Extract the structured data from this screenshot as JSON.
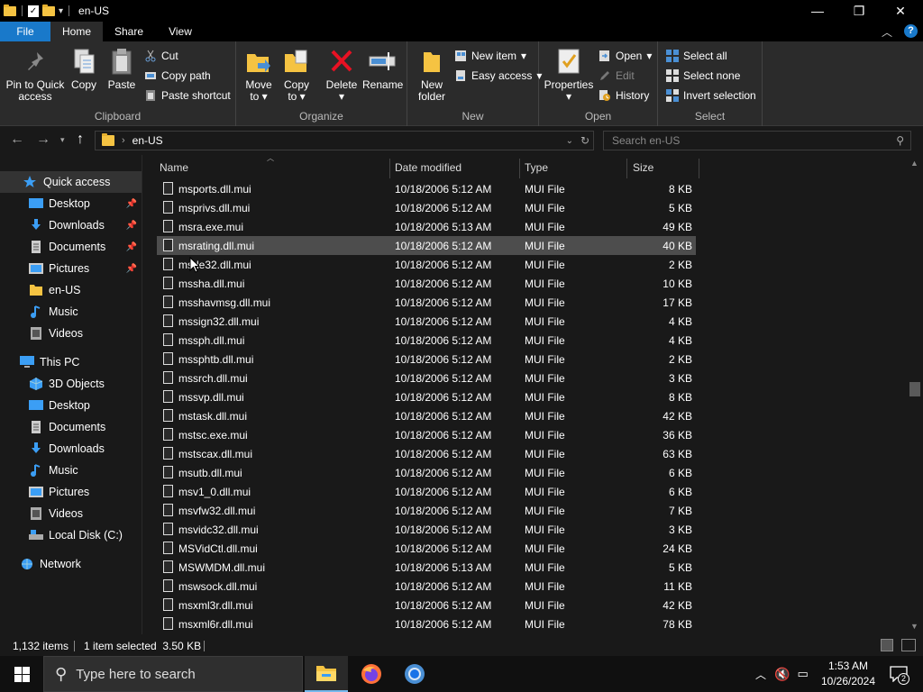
{
  "window": {
    "title": "en-US",
    "controls": {
      "minimize": "—",
      "maximize": "❐",
      "close": "✕"
    }
  },
  "ribbon_tabs": [
    {
      "label": "File"
    },
    {
      "label": "Home"
    },
    {
      "label": "Share"
    },
    {
      "label": "View"
    }
  ],
  "ribbon": {
    "clipboard": {
      "label": "Clipboard",
      "pin": "Pin to Quick\naccess",
      "pin_l1": "Pin to Quick",
      "pin_l2": "access",
      "copy": "Copy",
      "paste": "Paste",
      "cut": "Cut",
      "copy_path": "Copy path",
      "paste_shortcut": "Paste shortcut"
    },
    "organize": {
      "label": "Organize",
      "move_l1": "Move",
      "move_l2": "to",
      "copy_l1": "Copy",
      "copy_l2": "to",
      "delete": "Delete",
      "rename": "Rename"
    },
    "new": {
      "label": "New",
      "folder_l1": "New",
      "folder_l2": "folder",
      "new_item": "New item",
      "easy_access": "Easy access"
    },
    "open": {
      "label": "Open",
      "properties": "Properties",
      "open": "Open",
      "edit": "Edit",
      "history": "History"
    },
    "select": {
      "label": "Select",
      "select_all": "Select all",
      "select_none": "Select none",
      "invert": "Invert selection"
    }
  },
  "address": {
    "path": "en-US",
    "search_placeholder": "Search en-US"
  },
  "nav": {
    "quick_access": "Quick access",
    "items": [
      {
        "label": "Desktop",
        "icon": "desktop-icon",
        "pinned": true
      },
      {
        "label": "Downloads",
        "icon": "downloads-icon",
        "pinned": true
      },
      {
        "label": "Documents",
        "icon": "documents-icon",
        "pinned": true
      },
      {
        "label": "Pictures",
        "icon": "pictures-icon",
        "pinned": true
      },
      {
        "label": "en-US",
        "icon": "folder-icon",
        "pinned": false
      },
      {
        "label": "Music",
        "icon": "music-icon",
        "pinned": false
      },
      {
        "label": "Videos",
        "icon": "videos-icon",
        "pinned": false
      }
    ],
    "this_pc": "This PC",
    "pc_items": [
      {
        "label": "3D Objects",
        "icon": "3d-objects-icon"
      },
      {
        "label": "Desktop",
        "icon": "desktop-icon"
      },
      {
        "label": "Documents",
        "icon": "documents-icon"
      },
      {
        "label": "Downloads",
        "icon": "downloads-icon"
      },
      {
        "label": "Music",
        "icon": "music-icon"
      },
      {
        "label": "Pictures",
        "icon": "pictures-icon"
      },
      {
        "label": "Videos",
        "icon": "videos-icon"
      },
      {
        "label": "Local Disk (C:)",
        "icon": "local-disk-icon"
      }
    ],
    "network": "Network"
  },
  "columns": {
    "name": "Name",
    "date": "Date modified",
    "type": "Type",
    "size": "Size"
  },
  "files": [
    {
      "name": "msports.dll.mui",
      "date": "10/18/2006 5:12 AM",
      "type": "MUI File",
      "size": "8 KB"
    },
    {
      "name": "msprivs.dll.mui",
      "date": "10/18/2006 5:12 AM",
      "type": "MUI File",
      "size": "5 KB"
    },
    {
      "name": "msra.exe.mui",
      "date": "10/18/2006 5:13 AM",
      "type": "MUI File",
      "size": "49 KB"
    },
    {
      "name": "msrating.dll.mui",
      "date": "10/18/2006 5:12 AM",
      "type": "MUI File",
      "size": "40 KB",
      "selected": true
    },
    {
      "name": "msrle32.dll.mui",
      "date": "10/18/2006 5:12 AM",
      "type": "MUI File",
      "size": "2 KB"
    },
    {
      "name": "mssha.dll.mui",
      "date": "10/18/2006 5:12 AM",
      "type": "MUI File",
      "size": "10 KB"
    },
    {
      "name": "msshavmsg.dll.mui",
      "date": "10/18/2006 5:12 AM",
      "type": "MUI File",
      "size": "17 KB"
    },
    {
      "name": "mssign32.dll.mui",
      "date": "10/18/2006 5:12 AM",
      "type": "MUI File",
      "size": "4 KB"
    },
    {
      "name": "mssph.dll.mui",
      "date": "10/18/2006 5:12 AM",
      "type": "MUI File",
      "size": "4 KB"
    },
    {
      "name": "mssphtb.dll.mui",
      "date": "10/18/2006 5:12 AM",
      "type": "MUI File",
      "size": "2 KB"
    },
    {
      "name": "mssrch.dll.mui",
      "date": "10/18/2006 5:12 AM",
      "type": "MUI File",
      "size": "3 KB"
    },
    {
      "name": "mssvp.dll.mui",
      "date": "10/18/2006 5:12 AM",
      "type": "MUI File",
      "size": "8 KB"
    },
    {
      "name": "mstask.dll.mui",
      "date": "10/18/2006 5:12 AM",
      "type": "MUI File",
      "size": "42 KB"
    },
    {
      "name": "mstsc.exe.mui",
      "date": "10/18/2006 5:12 AM",
      "type": "MUI File",
      "size": "36 KB"
    },
    {
      "name": "mstscax.dll.mui",
      "date": "10/18/2006 5:12 AM",
      "type": "MUI File",
      "size": "63 KB"
    },
    {
      "name": "msutb.dll.mui",
      "date": "10/18/2006 5:12 AM",
      "type": "MUI File",
      "size": "6 KB"
    },
    {
      "name": "msv1_0.dll.mui",
      "date": "10/18/2006 5:12 AM",
      "type": "MUI File",
      "size": "6 KB"
    },
    {
      "name": "msvfw32.dll.mui",
      "date": "10/18/2006 5:12 AM",
      "type": "MUI File",
      "size": "7 KB"
    },
    {
      "name": "msvidc32.dll.mui",
      "date": "10/18/2006 5:12 AM",
      "type": "MUI File",
      "size": "3 KB"
    },
    {
      "name": "MSVidCtl.dll.mui",
      "date": "10/18/2006 5:12 AM",
      "type": "MUI File",
      "size": "24 KB"
    },
    {
      "name": "MSWMDM.dll.mui",
      "date": "10/18/2006 5:13 AM",
      "type": "MUI File",
      "size": "5 KB"
    },
    {
      "name": "mswsock.dll.mui",
      "date": "10/18/2006 5:12 AM",
      "type": "MUI File",
      "size": "11 KB"
    },
    {
      "name": "msxml3r.dll.mui",
      "date": "10/18/2006 5:12 AM",
      "type": "MUI File",
      "size": "42 KB"
    },
    {
      "name": "msxml6r.dll.mui",
      "date": "10/18/2006 5:12 AM",
      "type": "MUI File",
      "size": "78 KB"
    }
  ],
  "status": {
    "count": "1,132 items",
    "selected": "1 item selected  3.50 KB"
  },
  "taskbar": {
    "search_placeholder": "Type here to search",
    "time": "1:53 AM",
    "date": "10/26/2024",
    "notifications": "2"
  },
  "colors": {
    "accent": "#1979ca",
    "folder": "#f5c342",
    "selection": "#4d4d4d"
  }
}
